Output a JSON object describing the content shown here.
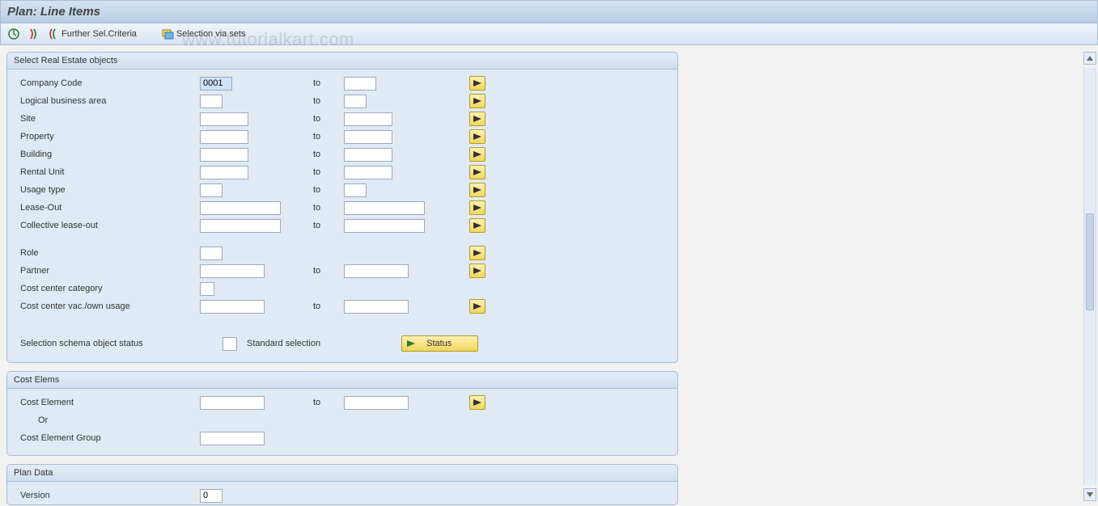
{
  "title": "Plan: Line Items",
  "watermark": "www.tutorialkart.com",
  "toolbar": {
    "further_criteria": "Further Sel.Criteria",
    "selection_via_sets": "Selection via sets"
  },
  "panels": {
    "real_estate": {
      "title": "Select Real Estate objects",
      "to_label": "to",
      "fields": {
        "company_code": {
          "label": "Company Code",
          "from": "0001",
          "to": ""
        },
        "logical_business_area": {
          "label": "Logical business area",
          "from": "",
          "to": ""
        },
        "site": {
          "label": "Site",
          "from": "",
          "to": ""
        },
        "property": {
          "label": "Property",
          "from": "",
          "to": ""
        },
        "building": {
          "label": "Building",
          "from": "",
          "to": ""
        },
        "rental_unit": {
          "label": "Rental Unit",
          "from": "",
          "to": ""
        },
        "usage_type": {
          "label": "Usage type",
          "from": "",
          "to": ""
        },
        "lease_out": {
          "label": "Lease-Out",
          "from": "",
          "to": ""
        },
        "collective_lease_out": {
          "label": "Collective lease-out",
          "from": "",
          "to": ""
        },
        "role": {
          "label": "Role",
          "from": ""
        },
        "partner": {
          "label": "Partner",
          "from": "",
          "to": ""
        },
        "cost_center_category": {
          "label": "Cost center category",
          "from": ""
        },
        "cost_center_vac": {
          "label": "Cost center vac./own usage",
          "from": "",
          "to": ""
        }
      },
      "status": {
        "label": "Selection schema object status",
        "value": "",
        "standard_label": "Standard selection",
        "button": "Status"
      }
    },
    "cost_elems": {
      "title": "Cost Elems",
      "to_label": "to",
      "cost_element": {
        "label": "Cost Element",
        "from": "",
        "to": ""
      },
      "or_label": "Or",
      "cost_element_group": {
        "label": "Cost Element Group",
        "value": ""
      }
    },
    "plan_data": {
      "title": "Plan Data",
      "version": {
        "label": "Version",
        "value": "0"
      }
    }
  }
}
